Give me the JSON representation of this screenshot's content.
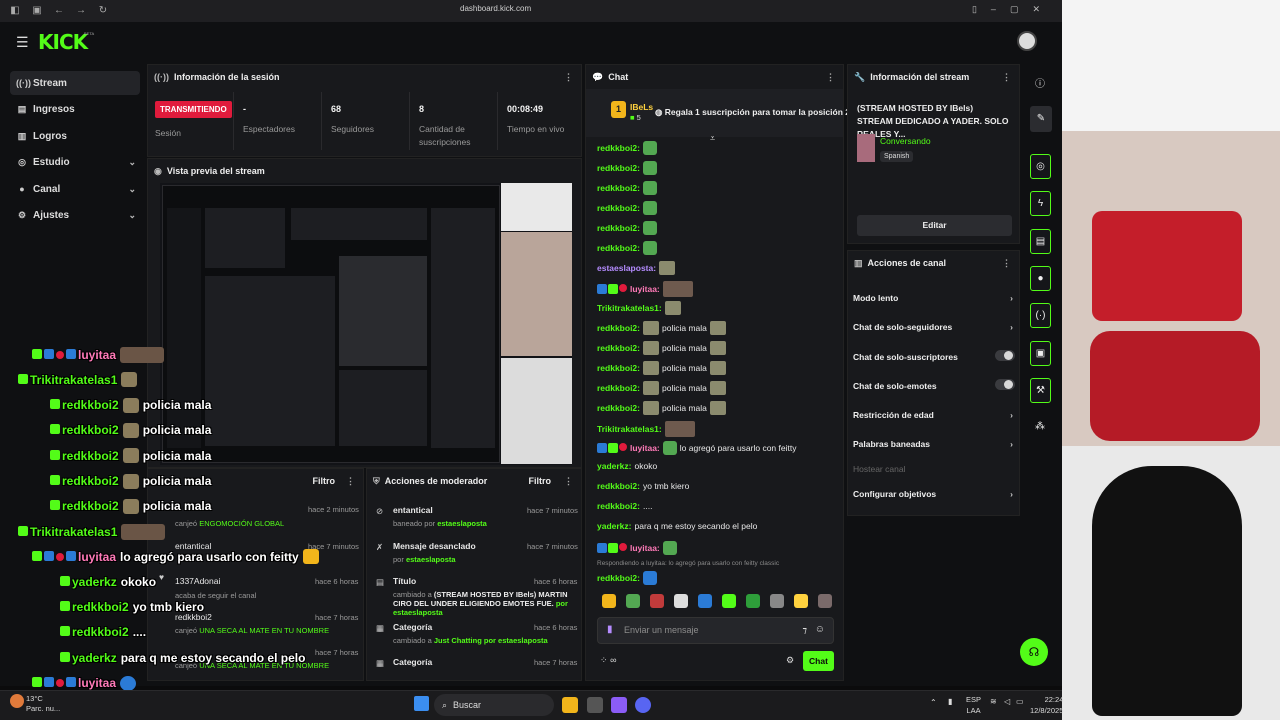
{
  "browser": {
    "url": "dashboard.kick.com"
  },
  "brand": {
    "logo": "KICK",
    "beta": "BETA",
    "accent": "#53fc18"
  },
  "sidebar": {
    "items": [
      {
        "label": "Stream",
        "icon": "broadcast-icon"
      },
      {
        "label": "Ingresos",
        "icon": "wallet-icon"
      },
      {
        "label": "Logros",
        "icon": "trophy-icon"
      },
      {
        "label": "Estudio",
        "icon": "studio-icon"
      },
      {
        "label": "Canal",
        "icon": "person-icon"
      },
      {
        "label": "Ajustes",
        "icon": "gear-icon"
      }
    ]
  },
  "session": {
    "title": "Información de la sesión",
    "status_badge": "TRANSMITIENDO",
    "status_label": "Sesión",
    "viewers_value": "-",
    "viewers_label": "Espectadores",
    "followers_value": "68",
    "followers_label": "Seguidores",
    "subs_value": "8",
    "subs_label": "Cantidad de suscripciones",
    "uptime_value": "00:08:49",
    "uptime_label": "Tiempo en vivo"
  },
  "preview": {
    "title": "Vista previa del stream"
  },
  "events_panel": {
    "filter": "Filtro",
    "rows": [
      {
        "name": "",
        "time": "hace 2 minutos",
        "sub_prefix": "canjeó",
        "sub_highlight": "ENGOMOCIÓN GLOBAL"
      },
      {
        "name": "entantical",
        "time": "hace 7 minutos",
        "sub_prefix": "",
        "sub_highlight": ""
      },
      {
        "name": "1337Adonai",
        "time": "hace 6 horas",
        "sub_prefix": "acaba de seguir el canal",
        "sub_highlight": ""
      },
      {
        "name": "redkkboi2",
        "time": "hace 7 horas",
        "sub_prefix": "canjeó",
        "sub_highlight": "UNA SECA AL MATE EN TU NOMBRE"
      },
      {
        "name": "",
        "time": "hace 7 horas",
        "sub_prefix": "canjeó",
        "sub_highlight": "UNA SECA AL MATE EN TU NOMBRE"
      }
    ]
  },
  "mod_actions": {
    "title": "Acciones de moderador",
    "filter": "Filtro",
    "rows": [
      {
        "title": "entantical",
        "time": "hace 7 minutos",
        "sub": "baneado por",
        "by": "estaeslaposta",
        "icon": "ban-icon"
      },
      {
        "title": "Mensaje desanclado",
        "time": "hace 7 minutos",
        "sub": "por",
        "by": "estaeslaposta",
        "icon": "unpin-icon"
      },
      {
        "title": "Título",
        "time": "hace 6 horas",
        "sub": "cambiado a",
        "by": "(STREAM HOSTED BY IBels) MARTIN CIRO DEL UNDER ELIGIENDO EMOTES FUE.",
        "by2": "por estaeslaposta",
        "icon": "text-icon"
      },
      {
        "title": "Categoría",
        "time": "hace 6 horas",
        "sub": "cambiado a",
        "by": "Just Chatting",
        "by2": "por estaeslaposta",
        "icon": "category-icon"
      },
      {
        "title": "Categoría",
        "time": "hace 7 horas",
        "sub": "",
        "by": "",
        "icon": "category-icon"
      }
    ]
  },
  "chat": {
    "title": "Chat",
    "top_gifter": {
      "name": "IBeLs",
      "count": "5",
      "message": "Regala 1 suscripción para tomar la posición 2"
    },
    "messages": [
      {
        "user": "redkkboi2:",
        "text": "",
        "color": "g",
        "emote": "emote"
      },
      {
        "user": "redkkboi2:",
        "text": "",
        "color": "g",
        "emote": "emote"
      },
      {
        "user": "redkkboi2:",
        "text": "",
        "color": "g",
        "emote": "emote"
      },
      {
        "user": "redkkboi2:",
        "text": "",
        "color": "g",
        "emote": "emote"
      },
      {
        "user": "redkkboi2:",
        "text": "",
        "color": "g",
        "emote": "emote"
      },
      {
        "user": "redkkboi2:",
        "text": "",
        "color": "g",
        "emote": "emote"
      },
      {
        "user": "estaeslaposta:",
        "text": "",
        "color": "p",
        "emote": "sq"
      },
      {
        "user": "luyitaa:",
        "text": "",
        "color": "pk",
        "emote": "face"
      },
      {
        "user": "Trikitrakatelas1:",
        "text": "",
        "color": "g",
        "emote": "sq"
      },
      {
        "user": "redkkboi2:",
        "text": "policia mala",
        "color": "g",
        "emote": "sq"
      },
      {
        "user": "redkkboi2:",
        "text": "policia mala",
        "color": "g",
        "emote": "sq"
      },
      {
        "user": "redkkboi2:",
        "text": "policia mala",
        "color": "g",
        "emote": "sq"
      },
      {
        "user": "redkkboi2:",
        "text": "policia mala",
        "color": "g",
        "emote": "sq"
      },
      {
        "user": "redkkboi2:",
        "text": "policia mala",
        "color": "g",
        "emote": "sq"
      },
      {
        "user": "Trikitrakatelas1:",
        "text": "",
        "color": "g",
        "emote": "face"
      },
      {
        "user": "luyitaa:",
        "text": "lo agregó para usarlo con feitty",
        "color": "pk",
        "emote": "emote"
      },
      {
        "user": "yaderkz:",
        "text": "okoko",
        "color": "g",
        "emote": ""
      },
      {
        "user": "redkkboi2:",
        "text": "yo tmb kiero",
        "color": "g",
        "emote": ""
      },
      {
        "user": "redkkboi2:",
        "text": "....",
        "color": "g",
        "emote": ""
      },
      {
        "user": "yaderkz:",
        "text": "para q me estoy secando el pelo",
        "color": "g",
        "emote": ""
      },
      {
        "user": "luyitaa:",
        "text": "",
        "color": "pk",
        "emote": "emote"
      }
    ],
    "reply_to": "Respondiendo a luyitaa: lo agregó para usarlo con feitty classic",
    "reply_user": "redkkboi2:",
    "input_placeholder": "Enviar un mensaje",
    "send_label": "Chat",
    "points": "∞"
  },
  "stream_info": {
    "title": "Información del stream",
    "stream_title": "(STREAM HOSTED BY IBels) STREAM DEDICADO A YADER. SOLO REALES Y...",
    "category": "Conversando",
    "language": "Spanish",
    "edit_label": "Editar"
  },
  "channel_actions": {
    "title": "Acciones de canal",
    "items": [
      {
        "label": "Modo lento",
        "kind": "arrow"
      },
      {
        "label": "Chat de solo-seguidores",
        "kind": "arrow"
      },
      {
        "label": "Chat de solo-suscriptores",
        "kind": "toggle"
      },
      {
        "label": "Chat de solo-emotes",
        "kind": "toggle"
      },
      {
        "label": "Restricción de edad",
        "kind": "arrow"
      },
      {
        "label": "Palabras baneadas",
        "kind": "arrow"
      },
      {
        "label": "Hostear canal",
        "kind": "disabled"
      },
      {
        "label": "Configurar objetivos",
        "kind": "arrow"
      }
    ]
  },
  "overlay_chat": [
    {
      "name": "luyitaa",
      "text": "",
      "cls": "pk"
    },
    {
      "name": "Trikitrakatelas1",
      "text": "",
      "cls": "g"
    },
    {
      "name": "redkkboi2",
      "text": "policia mala",
      "cls": "g"
    },
    {
      "name": "redkkboi2",
      "text": "policia mala",
      "cls": "g"
    },
    {
      "name": "redkkboi2",
      "text": "policia mala",
      "cls": "g"
    },
    {
      "name": "redkkboi2",
      "text": "policia mala",
      "cls": "g"
    },
    {
      "name": "redkkboi2",
      "text": "policia mala",
      "cls": "g"
    },
    {
      "name": "Trikitrakatelas1",
      "text": "",
      "cls": "g"
    },
    {
      "name": "luyitaa",
      "text": "lo agregó para usarlo con feitty",
      "cls": "pk"
    },
    {
      "name": "yaderkz",
      "text": "okoko",
      "cls": "g"
    },
    {
      "name": "redkkboi2",
      "text": "yo tmb kiero",
      "cls": "g"
    },
    {
      "name": "redkkboi2",
      "text": "....",
      "cls": "g"
    },
    {
      "name": "yaderkz",
      "text": "para q me estoy secando el pelo",
      "cls": "g"
    },
    {
      "name": "luyitaa",
      "text": "",
      "cls": "pk"
    },
    {
      "name": "redkkboi2",
      "text": "",
      "cls": "g"
    }
  ],
  "taskbar": {
    "search": "Buscar",
    "weather_temp": "13°C",
    "weather_desc": "Parc. nu...",
    "lang_top": "ESP",
    "lang_bottom": "LAA",
    "time": "22:24",
    "date": "12/8/2025"
  }
}
